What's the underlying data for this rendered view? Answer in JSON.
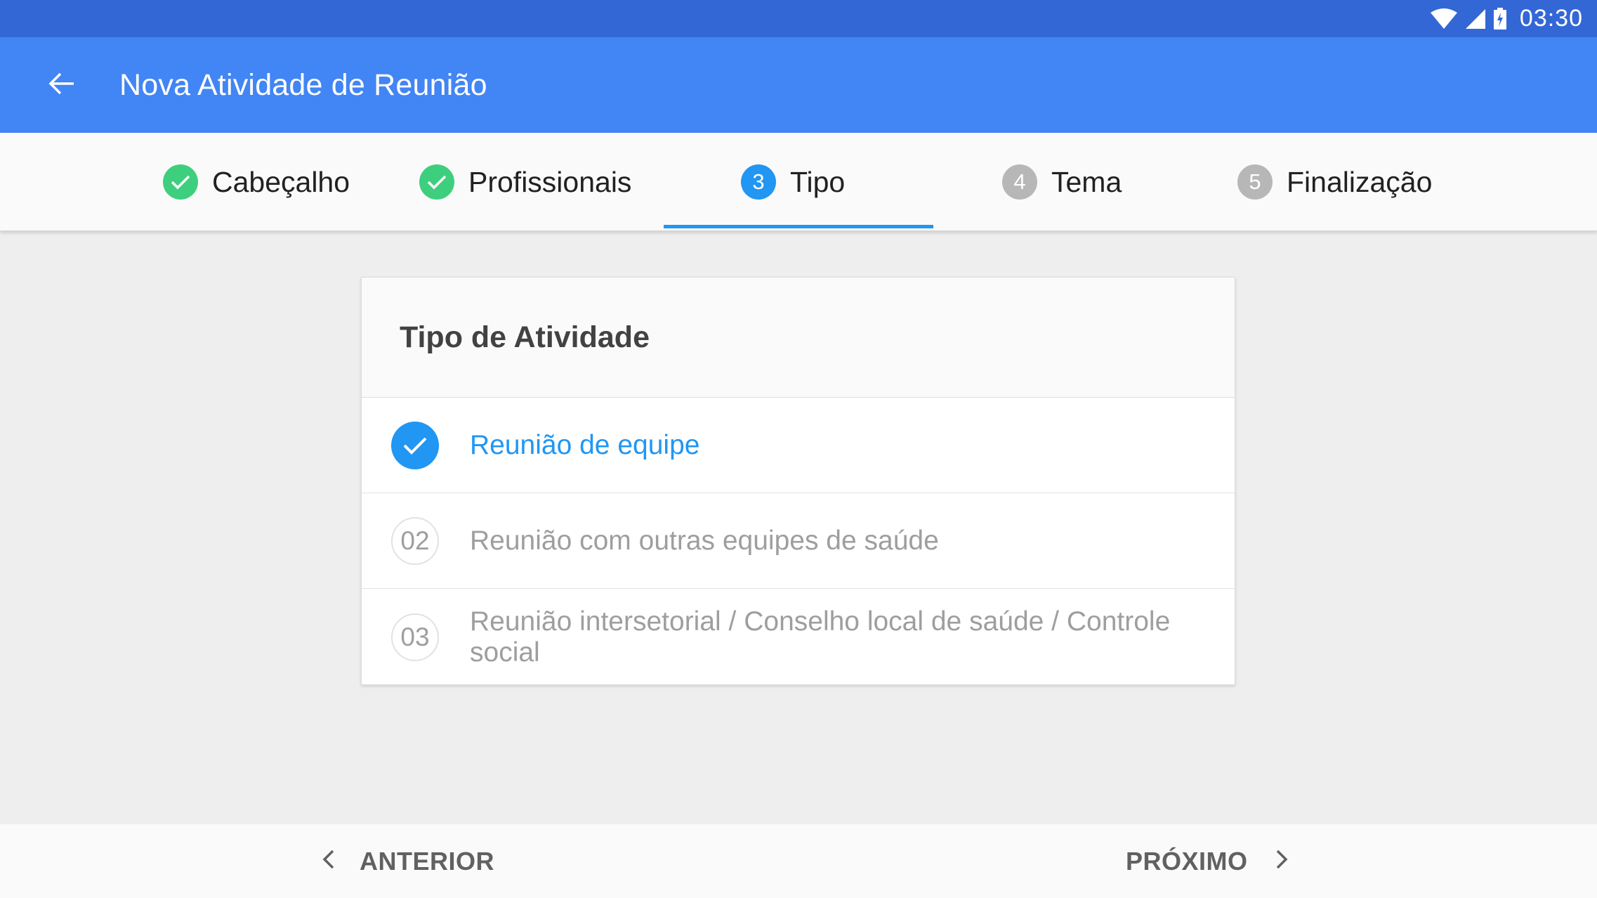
{
  "status_bar": {
    "time": "03:30",
    "icons": [
      "wifi-icon",
      "cell-signal-icon",
      "battery-charging-icon"
    ]
  },
  "app_bar": {
    "back_icon": "arrow-back-icon",
    "title": "Nova Atividade de Reunião"
  },
  "stepper": {
    "steps": [
      {
        "number": "1",
        "label": "Cabeçalho",
        "state": "done"
      },
      {
        "number": "2",
        "label": "Profissionais",
        "state": "done"
      },
      {
        "number": "3",
        "label": "Tipo",
        "state": "current"
      },
      {
        "number": "4",
        "label": "Tema",
        "state": "pending"
      },
      {
        "number": "5",
        "label": "Finalização",
        "state": "pending"
      }
    ]
  },
  "card": {
    "title": "Tipo de Atividade",
    "options": [
      {
        "code": "01",
        "text": "Reunião de equipe",
        "selected": true
      },
      {
        "code": "02",
        "text": "Reunião com outras equipes de saúde",
        "selected": false
      },
      {
        "code": "03",
        "text": "Reunião intersetorial / Conselho local de saúde / Controle social",
        "selected": false
      }
    ]
  },
  "navigation": {
    "previous_label": "ANTERIOR",
    "next_label": "PRÓXIMO"
  },
  "colors": {
    "status_bar": "#3367d6",
    "app_bar": "#4285f4",
    "accent": "#2196f3",
    "done": "#3ecf7e",
    "pending": "#b7b7b7"
  }
}
